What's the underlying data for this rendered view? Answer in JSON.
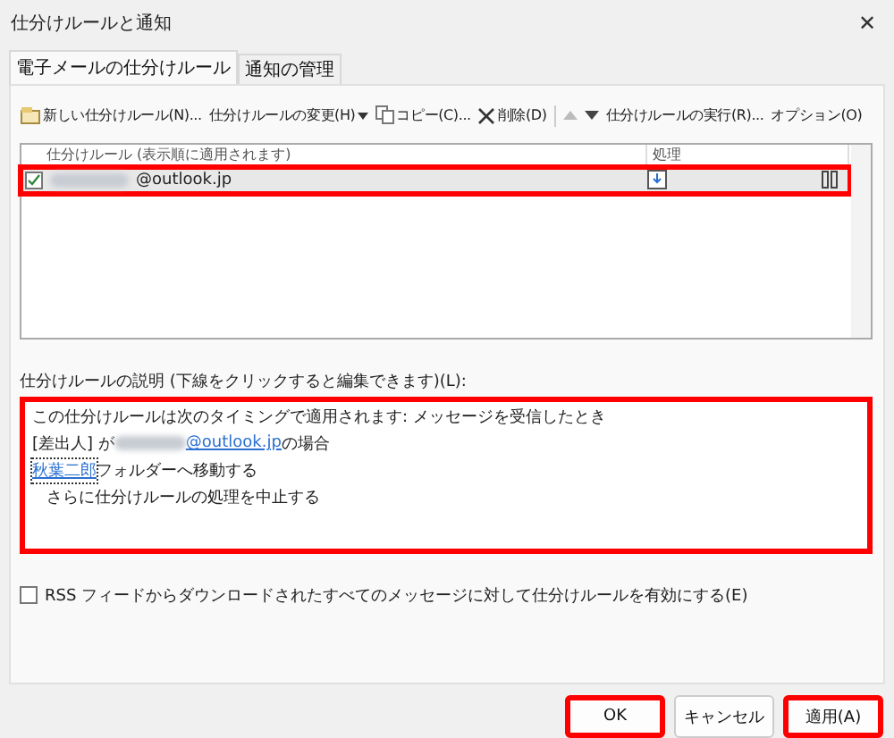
{
  "window": {
    "title": "仕分けルールと通知",
    "close": "✕"
  },
  "tabs": [
    {
      "label": "電子メールの仕分けルール",
      "selected": true
    },
    {
      "label": "通知の管理",
      "selected": false
    }
  ],
  "toolbar": [
    {
      "kind": "new",
      "label": "新しい仕分けルール(N)..."
    },
    {
      "kind": "menu",
      "label": "仕分けルールの変更(H)"
    },
    {
      "kind": "copy",
      "label": "コピー(C)..."
    },
    {
      "kind": "delete",
      "label": "削除(D)"
    },
    {
      "kind": "up"
    },
    {
      "kind": "down"
    },
    {
      "kind": "text",
      "label": "仕分けルールの実行(R)..."
    },
    {
      "kind": "text",
      "label": "オプション(O)"
    }
  ],
  "rules_table": {
    "columns": [
      "仕分けルール (表示順に適用されます)",
      "処理"
    ],
    "rows": [
      {
        "checked": true,
        "name": "@outlook.jp",
        "highlighted": true
      }
    ]
  },
  "description": {
    "label": "仕分けルールの説明 (下線をクリックすると編集できます)(L):",
    "highlighted": true,
    "lines": [
      [
        {
          "kind": "text",
          "text": "この仕分けルールは次のタイミングで適用されます: メッセージを受信したとき"
        }
      ],
      [
        {
          "kind": "text",
          "text": "[差出人] が "
        },
        {
          "kind": "redacted"
        },
        {
          "kind": "link",
          "text": "@outlook.jp"
        },
        {
          "kind": "text",
          "text": " の場合"
        }
      ],
      [
        {
          "kind": "focus-link",
          "text": "秋葉二郎"
        },
        {
          "kind": "text",
          "text": " フォルダーへ移動する"
        }
      ],
      [
        {
          "kind": "indent",
          "text": "さらに仕分けルールの処理を中止する"
        }
      ]
    ]
  },
  "rss_option": {
    "label": "RSS フィードからダウンロードされたすべてのメッセージに対して仕分けルールを有効にする(E)",
    "checked": false
  },
  "buttons": [
    {
      "label": "OK",
      "highlighted": true
    },
    {
      "label": "キャンセル",
      "highlighted": false
    },
    {
      "label": "適用(A)",
      "highlighted": true
    }
  ]
}
